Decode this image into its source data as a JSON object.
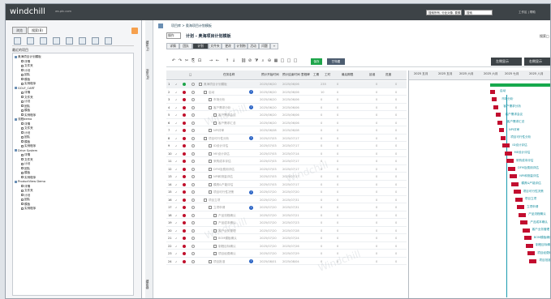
{
  "app": {
    "brand": "windchill",
    "sub": "ws.ptc.com"
  },
  "topbar": {
    "search_scope": "搜索所有, 分此对象, 要素搜索",
    "search_value": "搜索",
    "user": "工作区 | 帮助"
  },
  "left": {
    "tabs": [
      "浏览",
      "搜索(B)"
    ],
    "section_title": "最近的项目",
    "tree": [
      {
        "label": "奥海项目计划模板",
        "children": [
          "详情",
          "文件夹",
          "计划",
          "团队",
          "模板",
          "实例程序"
        ]
      },
      {
        "label": "GOLF_CART",
        "children": [
          "详情",
          "文件夹",
          "计划",
          "团队",
          "模板",
          "实例程序"
        ]
      },
      {
        "label": "流程demo",
        "children": [
          "详情",
          "文件夹",
          "计划",
          "团队",
          "模板",
          "实例程序"
        ]
      },
      {
        "label": "Drive System",
        "children": [
          "详情",
          "文件夹",
          "计划",
          "团队",
          "模板",
          "实例程序"
        ]
      },
      {
        "label": "ProductView Demo",
        "children": [
          "详情",
          "文件夹",
          "计划",
          "团队",
          "模板",
          "实例程序"
        ]
      }
    ],
    "vertical_tabs": [
      "搜索(S)",
      "浏览(B)",
      "搜索器"
    ]
  },
  "main": {
    "breadcrumb": "项目库 > 奥海项目计划模板",
    "view_select": "操作",
    "page_title": "计划 - 奥海项目计划模板",
    "header_right": [
      "搜索",
      "□"
    ],
    "subtabs": [
      "详情",
      "团队",
      "计划",
      "文件夹",
      "更改",
      "计划物",
      "活动",
      "问题",
      "+"
    ],
    "toolbar_green": "保存",
    "toolbar_blue": "甘特图",
    "left_display": "左侧显示",
    "right_display": "右侧显示"
  },
  "grid": {
    "headers": [
      "□",
      "任务名称",
      "预计开始时间",
      "预计结束时间",
      "里程碑",
      "工期",
      "工时",
      "最后期限",
      "延误",
      "进度"
    ],
    "rows": [
      {
        "num": "1",
        "name": "奥海项目计划模板",
        "start": "2025/06/20",
        "end": "2025/06/06",
        "dur": "235",
        "work": "0",
        "late": "",
        "prog": "0",
        "indent": 0,
        "status": "green"
      },
      {
        "num": "2",
        "name": "启动",
        "start": "2025/06/20",
        "end": "2025/06/06",
        "dur": "10",
        "work": "0",
        "late": "",
        "prog": "0",
        "indent": 1,
        "status": "red",
        "info": true
      },
      {
        "num": "3",
        "name": "市场分析",
        "start": "2025/06/20",
        "end": "2025/06/06",
        "dur": "0",
        "work": "0",
        "late": "",
        "prog": "0",
        "indent": 2,
        "status": "red"
      },
      {
        "num": "4",
        "name": "客户需求分析",
        "start": "2025/06/20",
        "end": "2025/06/06",
        "dur": "0",
        "work": "0",
        "late": "",
        "prog": "0",
        "indent": 2,
        "status": "red",
        "info": true
      },
      {
        "num": "5",
        "name": "客户需求会议",
        "start": "2025/06/20",
        "end": "2025/06/06",
        "dur": "0",
        "work": "0",
        "late": "",
        "prog": "0",
        "indent": 3,
        "status": "red"
      },
      {
        "num": "6",
        "name": "客户需求汇总",
        "start": "2025/06/20",
        "end": "2025/06/06",
        "dur": "0",
        "work": "0",
        "late": "",
        "prog": "0",
        "indent": 3,
        "status": "red"
      },
      {
        "num": "7",
        "name": "NPI评审",
        "start": "2025/06/08",
        "end": "2025/06/08",
        "dur": "0",
        "work": "0",
        "late": "",
        "prog": "0",
        "indent": 2,
        "status": "red"
      },
      {
        "num": "8",
        "name": "项目可行性分析",
        "start": "2025/07/03",
        "end": "2025/07/17",
        "dur": "0",
        "work": "0",
        "late": "",
        "prog": "0",
        "indent": 1,
        "status": "red",
        "info": true
      },
      {
        "num": "9",
        "name": "ID设计评估",
        "start": "2025/07/03",
        "end": "2025/07/17",
        "dur": "0",
        "work": "0",
        "late": "",
        "prog": "0",
        "indent": 2,
        "status": "red"
      },
      {
        "num": "10",
        "name": "ME设计评估",
        "start": "2025/07/03",
        "end": "2025/07/14",
        "dur": "0",
        "work": "0",
        "late": "",
        "prog": "0",
        "indent": 2,
        "status": "red"
      },
      {
        "num": "11",
        "name": "采购成本评估",
        "start": "2025/07/03",
        "end": "2025/07/17",
        "dur": "0",
        "work": "0",
        "late": "",
        "prog": "0",
        "indent": 2,
        "status": "red"
      },
      {
        "num": "12",
        "name": "DFM及费用评估",
        "start": "2025/07/03",
        "end": "2025/07/17",
        "dur": "0",
        "work": "0",
        "late": "",
        "prog": "0",
        "indent": 2,
        "status": "red"
      },
      {
        "num": "13",
        "name": "NPI和测量评估",
        "start": "2025/07/03",
        "end": "2025/07/17",
        "dur": "0",
        "work": "0",
        "late": "",
        "prog": "0",
        "indent": 2,
        "status": "red"
      },
      {
        "num": "14",
        "name": "模具&产能评估",
        "start": "2025/07/03",
        "end": "2025/07/17",
        "dur": "0",
        "work": "0",
        "late": "",
        "prog": "0",
        "indent": 2,
        "status": "red"
      },
      {
        "num": "15",
        "name": "项目可行性决策",
        "start": "2025/07/20",
        "end": "2025/07/20",
        "dur": "0",
        "work": "0",
        "late": "",
        "prog": "0",
        "indent": 2,
        "status": "red",
        "info": true
      },
      {
        "num": "16",
        "name": "项目立项",
        "start": "2025/07/20",
        "end": "2025/07/31",
        "dur": "0",
        "work": "0",
        "late": "",
        "prog": "0",
        "indent": 1,
        "status": "red"
      },
      {
        "num": "17",
        "name": "立项申请",
        "start": "2025/07/20",
        "end": "2025/07/31",
        "dur": "0",
        "work": "0",
        "late": "",
        "prog": "0",
        "indent": 2,
        "status": "red",
        "info": true
      },
      {
        "num": "18",
        "name": "产品流程确认",
        "start": "2025/07/20",
        "end": "2025/07/21",
        "dur": "0",
        "work": "0",
        "late": "",
        "prog": "0",
        "indent": 3,
        "status": "red"
      },
      {
        "num": "19",
        "name": "产品成本确认",
        "start": "2025/07/20",
        "end": "2025/07/23",
        "dur": "0",
        "work": "0",
        "late": "",
        "prog": "0",
        "indent": 3,
        "status": "red"
      },
      {
        "num": "20",
        "name": "客户业务管理",
        "start": "2025/07/20",
        "end": "2025/07/28",
        "dur": "0",
        "work": "0",
        "late": "",
        "prog": "0",
        "indent": 3,
        "status": "red"
      },
      {
        "num": "21",
        "name": "BOM模板确认",
        "start": "2025/07/20",
        "end": "2025/07/24",
        "dur": "0",
        "work": "0",
        "late": "",
        "prog": "0",
        "indent": 3,
        "status": "red"
      },
      {
        "num": "22",
        "name": "制程目标确认",
        "start": "2025/07/20",
        "end": "2025/07/26",
        "dur": "0",
        "work": "0",
        "late": "",
        "prog": "0",
        "indent": 3,
        "status": "red"
      },
      {
        "num": "23",
        "name": "项目经费确认",
        "start": "2025/07/20",
        "end": "2025/07/29",
        "dur": "0",
        "work": "0",
        "late": "",
        "prog": "0",
        "indent": 3,
        "status": "red"
      },
      {
        "num": "24",
        "name": "项目批准",
        "start": "2025/08/01",
        "end": "2025/08/04",
        "dur": "0",
        "work": "0",
        "late": "",
        "prog": "0",
        "indent": 2,
        "status": "red",
        "info": true
      }
    ]
  },
  "gantt": {
    "months": [
      "2025 五月",
      "2025 五月",
      "2025 六月",
      "2025 六月",
      "2025 七月",
      "2025 八月"
    ],
    "labels": [
      "启动",
      "市场分析",
      "客户需求分析",
      "客户需求会议",
      "客户需求汇总",
      "NPI评审",
      "项目可行性分析",
      "ID设计评估",
      "ME设计评估",
      "采购成本评估",
      "DFM及费用评估",
      "NPI和测量评估",
      "模具&产能评估",
      "项目可行性决策",
      "项目立项",
      "立项申请",
      "产品流程确认",
      "产品成本确认",
      "客户业务管理",
      "BOM模板确认",
      "制程目标确认",
      "项目经费确认",
      "项目批准"
    ]
  }
}
